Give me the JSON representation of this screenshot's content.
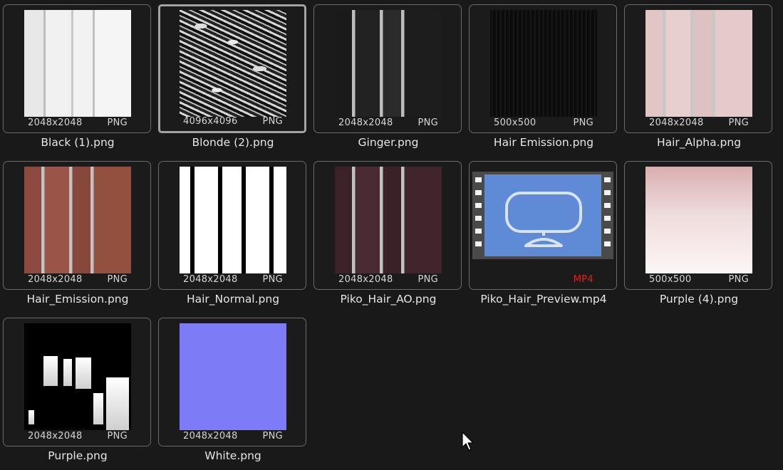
{
  "files": [
    {
      "name": "Black (1).png",
      "dim": "2048x2048",
      "type": "PNG",
      "thumb": "white-strands-icon"
    },
    {
      "name": "Blonde (2).png",
      "dim": "4096x4096",
      "type": "PNG",
      "thumb": "scattered-strands-icon"
    },
    {
      "name": "Ginger.png",
      "dim": "2048x2048",
      "type": "PNG",
      "thumb": "black-strands-icon"
    },
    {
      "name": "Hair Emission.png",
      "dim": "500x500",
      "type": "PNG",
      "thumb": "dark-streaks-icon"
    },
    {
      "name": "Hair_Alpha.png",
      "dim": "2048x2048",
      "type": "PNG",
      "thumb": "pink-strands-icon"
    },
    {
      "name": "Hair_Emission.png",
      "dim": "2048x2048",
      "type": "PNG",
      "thumb": "red-strands-icon"
    },
    {
      "name": "Hair_Normal.png",
      "dim": "2048x2048",
      "type": "PNG",
      "thumb": "bw-mask-icon"
    },
    {
      "name": "Piko_Hair_AO.png",
      "dim": "2048x2048",
      "type": "PNG",
      "thumb": "ao-strands-icon"
    },
    {
      "name": "Piko_Hair_Preview.mp4",
      "dim": "",
      "type": "MP4",
      "thumb": "video-film-icon"
    },
    {
      "name": "Purple (4).png",
      "dim": "500x500",
      "type": "PNG",
      "thumb": "pink-gradient-icon"
    },
    {
      "name": "Purple.png",
      "dim": "2048x2048",
      "type": "PNG",
      "thumb": "mask-blocks-icon"
    },
    {
      "name": "White.png",
      "dim": "2048x2048",
      "type": "PNG",
      "thumb": "normal-map-icon"
    }
  ],
  "selected_index": 1,
  "colors": {
    "background": "#191919",
    "border": "#6a6a6a",
    "selected_border": "#a3a3a3",
    "video_label": "#e0231a"
  }
}
